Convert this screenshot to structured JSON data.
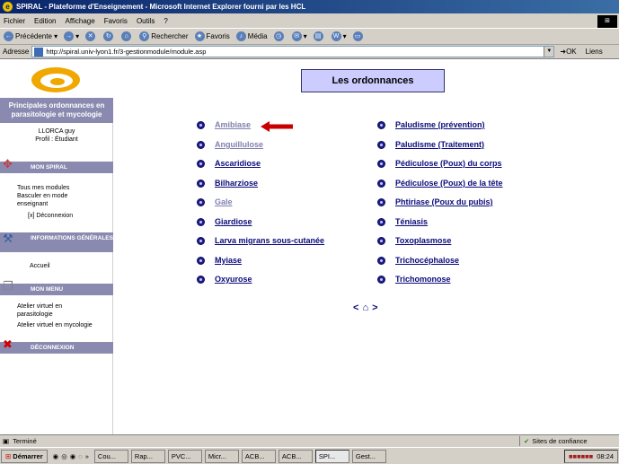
{
  "window": {
    "title": "SPIRAL - Plateforme d'Enseignement - Microsoft Internet Explorer fourni par les HCL"
  },
  "menu": [
    "Fichier",
    "Edition",
    "Affichage",
    "Favoris",
    "Outils",
    "?"
  ],
  "toolbar": {
    "back": "Précédente",
    "search": "Rechercher",
    "favorites": "Favoris",
    "media": "Média"
  },
  "address": {
    "label": "Adresse",
    "url": "http://spiral.univ-lyon1.fr/3-gestionmodule/module.asp",
    "go": "OK",
    "links": "Liens"
  },
  "sidebar": {
    "site_title": "Principales ordonnances en parasitologie et mycologie",
    "user_name": "LLORCA guy",
    "user_profile": "Profil : Étudiant",
    "sections": [
      {
        "label": "MON SPIRAL",
        "items": [
          "Tous mes modules",
          "Basculer en mode enseignant",
          "[x] Déconnexion"
        ]
      },
      {
        "label": "INFORMATIONS GÉNÉRALES",
        "items": [
          "Accueil"
        ]
      },
      {
        "label": "MON MENU",
        "items": [
          "Atelier virtuel en parasitologie",
          "Atelier virtuel en mycologie"
        ]
      },
      {
        "label": "DÉCONNEXION",
        "items": []
      }
    ]
  },
  "main": {
    "title": "Les ordonnances",
    "left_list": [
      "Amibiase",
      "Anguillulose",
      "Ascaridiose",
      "Bilharziose",
      "Gale",
      "Giardiose",
      "Larva migrans sous-cutanée",
      "Myiase",
      "Oxyurose"
    ],
    "right_list": [
      "Paludisme (prévention)",
      "Paludisme (Traitement)",
      "Pédiculose (Poux) du corps",
      "Pédiculose (Poux) de la tête",
      "Phtiriase (Poux du pubis)",
      "Téniasis",
      "Toxoplasmose",
      "Trichocéphalose",
      "Trichomonose"
    ],
    "nav": {
      "prev": "<",
      "home": "⌂",
      "next": ">"
    }
  },
  "status": {
    "text": "Terminé",
    "zone": "Sites de confiance"
  },
  "taskbar": {
    "start": "Démarrer",
    "tasks": [
      "Cou...",
      "Rap...",
      "PVC...",
      "Micr...",
      "ACB...",
      "ACB...",
      "SPI...",
      "Gest..."
    ],
    "clock": "08:24"
  }
}
